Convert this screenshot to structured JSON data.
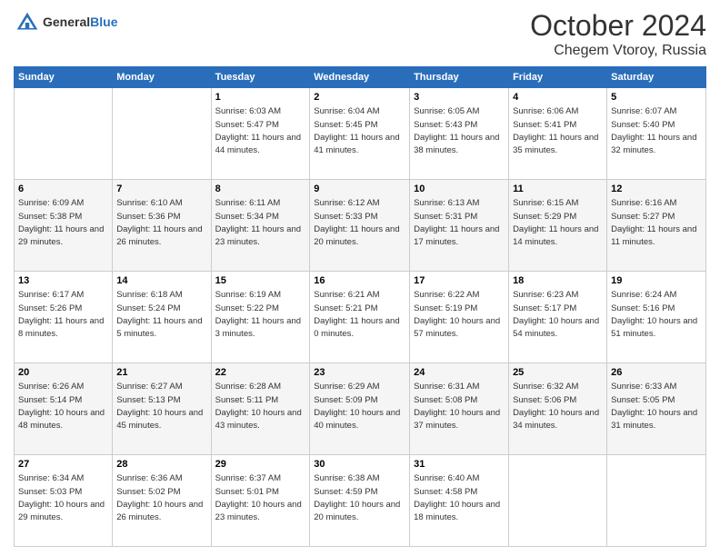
{
  "logo": {
    "text_general": "General",
    "text_blue": "Blue"
  },
  "title": "October 2024",
  "location": "Chegem Vtoroy, Russia",
  "days_of_week": [
    "Sunday",
    "Monday",
    "Tuesday",
    "Wednesday",
    "Thursday",
    "Friday",
    "Saturday"
  ],
  "weeks": [
    [
      {
        "day": "",
        "info": ""
      },
      {
        "day": "",
        "info": ""
      },
      {
        "day": "1",
        "sunrise": "Sunrise: 6:03 AM",
        "sunset": "Sunset: 5:47 PM",
        "daylight": "Daylight: 11 hours and 44 minutes."
      },
      {
        "day": "2",
        "sunrise": "Sunrise: 6:04 AM",
        "sunset": "Sunset: 5:45 PM",
        "daylight": "Daylight: 11 hours and 41 minutes."
      },
      {
        "day": "3",
        "sunrise": "Sunrise: 6:05 AM",
        "sunset": "Sunset: 5:43 PM",
        "daylight": "Daylight: 11 hours and 38 minutes."
      },
      {
        "day": "4",
        "sunrise": "Sunrise: 6:06 AM",
        "sunset": "Sunset: 5:41 PM",
        "daylight": "Daylight: 11 hours and 35 minutes."
      },
      {
        "day": "5",
        "sunrise": "Sunrise: 6:07 AM",
        "sunset": "Sunset: 5:40 PM",
        "daylight": "Daylight: 11 hours and 32 minutes."
      }
    ],
    [
      {
        "day": "6",
        "sunrise": "Sunrise: 6:09 AM",
        "sunset": "Sunset: 5:38 PM",
        "daylight": "Daylight: 11 hours and 29 minutes."
      },
      {
        "day": "7",
        "sunrise": "Sunrise: 6:10 AM",
        "sunset": "Sunset: 5:36 PM",
        "daylight": "Daylight: 11 hours and 26 minutes."
      },
      {
        "day": "8",
        "sunrise": "Sunrise: 6:11 AM",
        "sunset": "Sunset: 5:34 PM",
        "daylight": "Daylight: 11 hours and 23 minutes."
      },
      {
        "day": "9",
        "sunrise": "Sunrise: 6:12 AM",
        "sunset": "Sunset: 5:33 PM",
        "daylight": "Daylight: 11 hours and 20 minutes."
      },
      {
        "day": "10",
        "sunrise": "Sunrise: 6:13 AM",
        "sunset": "Sunset: 5:31 PM",
        "daylight": "Daylight: 11 hours and 17 minutes."
      },
      {
        "day": "11",
        "sunrise": "Sunrise: 6:15 AM",
        "sunset": "Sunset: 5:29 PM",
        "daylight": "Daylight: 11 hours and 14 minutes."
      },
      {
        "day": "12",
        "sunrise": "Sunrise: 6:16 AM",
        "sunset": "Sunset: 5:27 PM",
        "daylight": "Daylight: 11 hours and 11 minutes."
      }
    ],
    [
      {
        "day": "13",
        "sunrise": "Sunrise: 6:17 AM",
        "sunset": "Sunset: 5:26 PM",
        "daylight": "Daylight: 11 hours and 8 minutes."
      },
      {
        "day": "14",
        "sunrise": "Sunrise: 6:18 AM",
        "sunset": "Sunset: 5:24 PM",
        "daylight": "Daylight: 11 hours and 5 minutes."
      },
      {
        "day": "15",
        "sunrise": "Sunrise: 6:19 AM",
        "sunset": "Sunset: 5:22 PM",
        "daylight": "Daylight: 11 hours and 3 minutes."
      },
      {
        "day": "16",
        "sunrise": "Sunrise: 6:21 AM",
        "sunset": "Sunset: 5:21 PM",
        "daylight": "Daylight: 11 hours and 0 minutes."
      },
      {
        "day": "17",
        "sunrise": "Sunrise: 6:22 AM",
        "sunset": "Sunset: 5:19 PM",
        "daylight": "Daylight: 10 hours and 57 minutes."
      },
      {
        "day": "18",
        "sunrise": "Sunrise: 6:23 AM",
        "sunset": "Sunset: 5:17 PM",
        "daylight": "Daylight: 10 hours and 54 minutes."
      },
      {
        "day": "19",
        "sunrise": "Sunrise: 6:24 AM",
        "sunset": "Sunset: 5:16 PM",
        "daylight": "Daylight: 10 hours and 51 minutes."
      }
    ],
    [
      {
        "day": "20",
        "sunrise": "Sunrise: 6:26 AM",
        "sunset": "Sunset: 5:14 PM",
        "daylight": "Daylight: 10 hours and 48 minutes."
      },
      {
        "day": "21",
        "sunrise": "Sunrise: 6:27 AM",
        "sunset": "Sunset: 5:13 PM",
        "daylight": "Daylight: 10 hours and 45 minutes."
      },
      {
        "day": "22",
        "sunrise": "Sunrise: 6:28 AM",
        "sunset": "Sunset: 5:11 PM",
        "daylight": "Daylight: 10 hours and 43 minutes."
      },
      {
        "day": "23",
        "sunrise": "Sunrise: 6:29 AM",
        "sunset": "Sunset: 5:09 PM",
        "daylight": "Daylight: 10 hours and 40 minutes."
      },
      {
        "day": "24",
        "sunrise": "Sunrise: 6:31 AM",
        "sunset": "Sunset: 5:08 PM",
        "daylight": "Daylight: 10 hours and 37 minutes."
      },
      {
        "day": "25",
        "sunrise": "Sunrise: 6:32 AM",
        "sunset": "Sunset: 5:06 PM",
        "daylight": "Daylight: 10 hours and 34 minutes."
      },
      {
        "day": "26",
        "sunrise": "Sunrise: 6:33 AM",
        "sunset": "Sunset: 5:05 PM",
        "daylight": "Daylight: 10 hours and 31 minutes."
      }
    ],
    [
      {
        "day": "27",
        "sunrise": "Sunrise: 6:34 AM",
        "sunset": "Sunset: 5:03 PM",
        "daylight": "Daylight: 10 hours and 29 minutes."
      },
      {
        "day": "28",
        "sunrise": "Sunrise: 6:36 AM",
        "sunset": "Sunset: 5:02 PM",
        "daylight": "Daylight: 10 hours and 26 minutes."
      },
      {
        "day": "29",
        "sunrise": "Sunrise: 6:37 AM",
        "sunset": "Sunset: 5:01 PM",
        "daylight": "Daylight: 10 hours and 23 minutes."
      },
      {
        "day": "30",
        "sunrise": "Sunrise: 6:38 AM",
        "sunset": "Sunset: 4:59 PM",
        "daylight": "Daylight: 10 hours and 20 minutes."
      },
      {
        "day": "31",
        "sunrise": "Sunrise: 6:40 AM",
        "sunset": "Sunset: 4:58 PM",
        "daylight": "Daylight: 10 hours and 18 minutes."
      },
      {
        "day": "",
        "info": ""
      },
      {
        "day": "",
        "info": ""
      }
    ]
  ]
}
